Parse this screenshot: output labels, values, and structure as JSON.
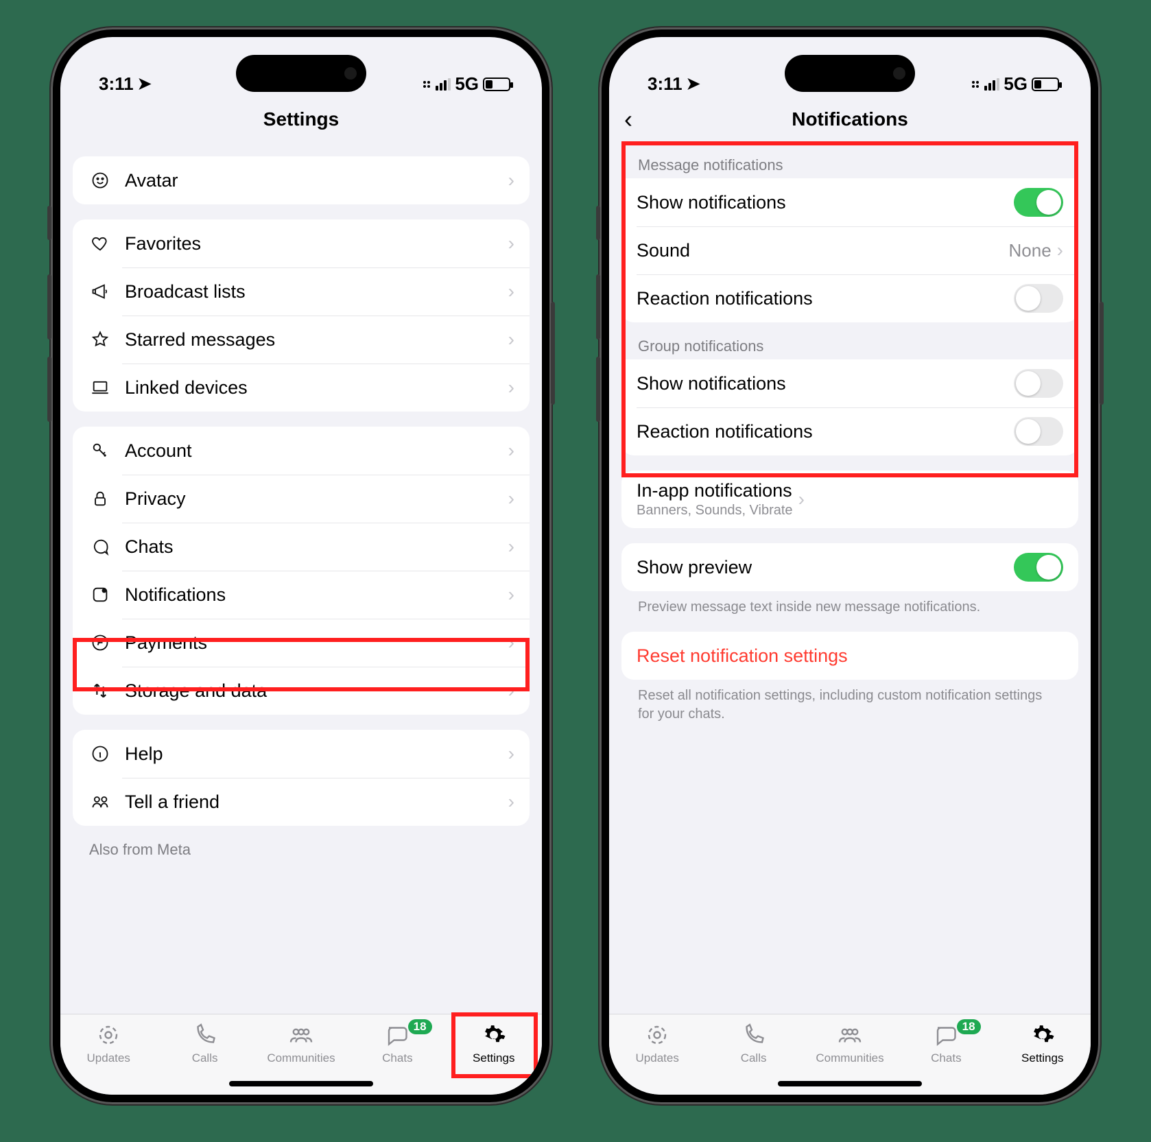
{
  "status": {
    "time": "3:11",
    "net": "5G"
  },
  "left": {
    "title": "Settings",
    "g1": {
      "avatar": "Avatar"
    },
    "g2": {
      "favorites": "Favorites",
      "broadcast": "Broadcast lists",
      "starred": "Starred messages",
      "linked": "Linked devices"
    },
    "g3": {
      "account": "Account",
      "privacy": "Privacy",
      "chats": "Chats",
      "notifications": "Notifications",
      "payments": "Payments",
      "storage": "Storage and data"
    },
    "g4": {
      "help": "Help",
      "tell": "Tell a friend"
    },
    "also": "Also from Meta"
  },
  "right": {
    "title": "Notifications",
    "msg_head": "Message notifications",
    "msg": {
      "show": "Show notifications",
      "sound": "Sound",
      "sound_val": "None",
      "reaction": "Reaction notifications"
    },
    "msg_toggle": {
      "show": true,
      "reaction": false
    },
    "grp_head": "Group notifications",
    "grp": {
      "show": "Show notifications",
      "reaction": "Reaction notifications"
    },
    "grp_toggle": {
      "show": false,
      "reaction": false
    },
    "inapp": "In-app notifications",
    "inapp_sub": "Banners, Sounds, Vibrate",
    "preview": "Show preview",
    "preview_on": true,
    "preview_note": "Preview message text inside new message notifications.",
    "reset": "Reset notification settings",
    "reset_note": "Reset all notification settings, including custom notification settings for your chats."
  },
  "tabs": {
    "updates": "Updates",
    "calls": "Calls",
    "communities": "Communities",
    "chats": "Chats",
    "settings": "Settings",
    "badge": "18"
  }
}
